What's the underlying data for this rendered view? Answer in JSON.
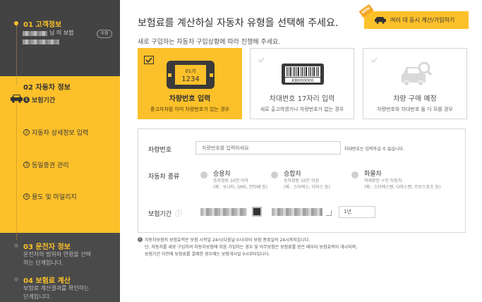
{
  "sidebar": {
    "step1": {
      "title": "01 고객정보",
      "name_suffix": "님 이 보험",
      "edit_label": "수정"
    },
    "step2": {
      "title": "02 자동차 정보",
      "items": [
        {
          "num": "1",
          "label": "보험기간"
        },
        {
          "num": "2",
          "label": "자동차 상세정보 입력"
        },
        {
          "num": "3",
          "label": "등일증권 관리"
        },
        {
          "num": "4",
          "label": "용도 및 마일리지"
        }
      ]
    },
    "step3": {
      "title": "03 운전자 정보",
      "desc": "운전자의 범위와 연령을 선택하는 단계입니다."
    },
    "step4": {
      "title": "04 보험료 계산",
      "desc": "보험료 계산결과를 확인하는 단계입니다."
    }
  },
  "header": {
    "title": "보험료를 계산하실 자동차 유형을 선택해 주세요.",
    "multi_button": "여러 대 동시 계산/가입하기",
    "new_badge": "NEW",
    "subtitle": "새로 구입하는 자동차 구입상황에 따라 진행해 주세요."
  },
  "options": [
    {
      "label": "차량번호 입력",
      "desc": "중고차처럼 이미 차량번호가 있는 경우",
      "plate_top": "01가",
      "plate_num": "1234",
      "active": true
    },
    {
      "label": "차대번호 17자리 입력",
      "desc": "새로 출고하였거나 차량번호가 없는 경우",
      "barcode_text": "KB000000",
      "active": false
    },
    {
      "label": "차량 구매 예정",
      "desc": "차량번호와 차대번호 둘 다 모를 경우",
      "active": false
    }
  ],
  "form": {
    "plate_label": "차량번호",
    "plate_placeholder": "차량번호를 입력하세요.",
    "plate_note": "차대번호는 입력하실 수 없습니다.",
    "type_label": "자동차 종류",
    "types": [
      {
        "title": "승용차",
        "sub1": "승차정원 10인 이하",
        "sub2": "(예 : 쏘나타, SM5, 전타페 등)"
      },
      {
        "title": "승합차",
        "sub1": "승차정원 10인 이상",
        "sub2": "(예 : 스타렉스, 다마스 등)"
      },
      {
        "title": "화물차",
        "sub1": "적재용인 ㅇ인 자동차",
        "sub2": "(예 : 스타렉스밴, 다마스밴, 무쏘스포츠 등)"
      }
    ],
    "period_label": "보험기간",
    "period_years": "1년"
  },
  "notes": [
    "자동차보험의 보험효력은 보험 시작일 24시(다음날 0시)부터 보험 종료일의 24시까지입니다.",
    "단, 자동차를 새로 구입하여 자동차보험에 처음 가입하는 경우 및 의무보험은 보험료를 받은 때부터 보험효력이 개시되며,",
    "보험기간 이전에 보험료를 결제한 경우에는 보험개시일 0시부터입니다."
  ],
  "colors": {
    "accent": "#fcc02a",
    "sidebar": "#3e3e3e"
  }
}
